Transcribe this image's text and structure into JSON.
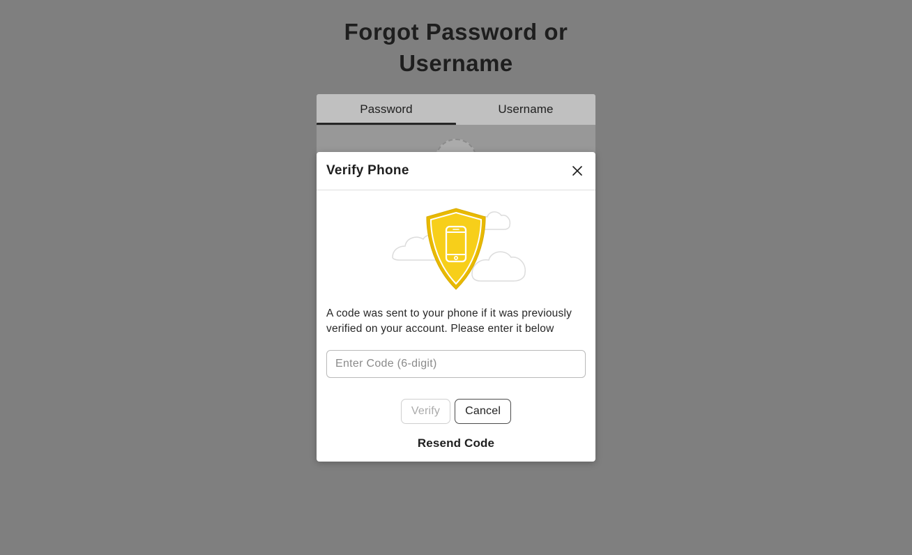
{
  "page": {
    "title": "Forgot Password or Username",
    "tabs": {
      "password": "Password",
      "username": "Username",
      "active": "password"
    }
  },
  "modal": {
    "title": "Verify Phone",
    "description": "A code was sent to your phone if it was previously verified on your account. Please enter it below",
    "input": {
      "placeholder": "Enter Code (6-digit)",
      "value": ""
    },
    "buttons": {
      "verify": "Verify",
      "cancel": "Cancel",
      "resend": "Resend Code"
    },
    "verify_enabled": false
  },
  "icons": {
    "close": "close-icon",
    "shield_phone": "shield-phone-icon"
  }
}
